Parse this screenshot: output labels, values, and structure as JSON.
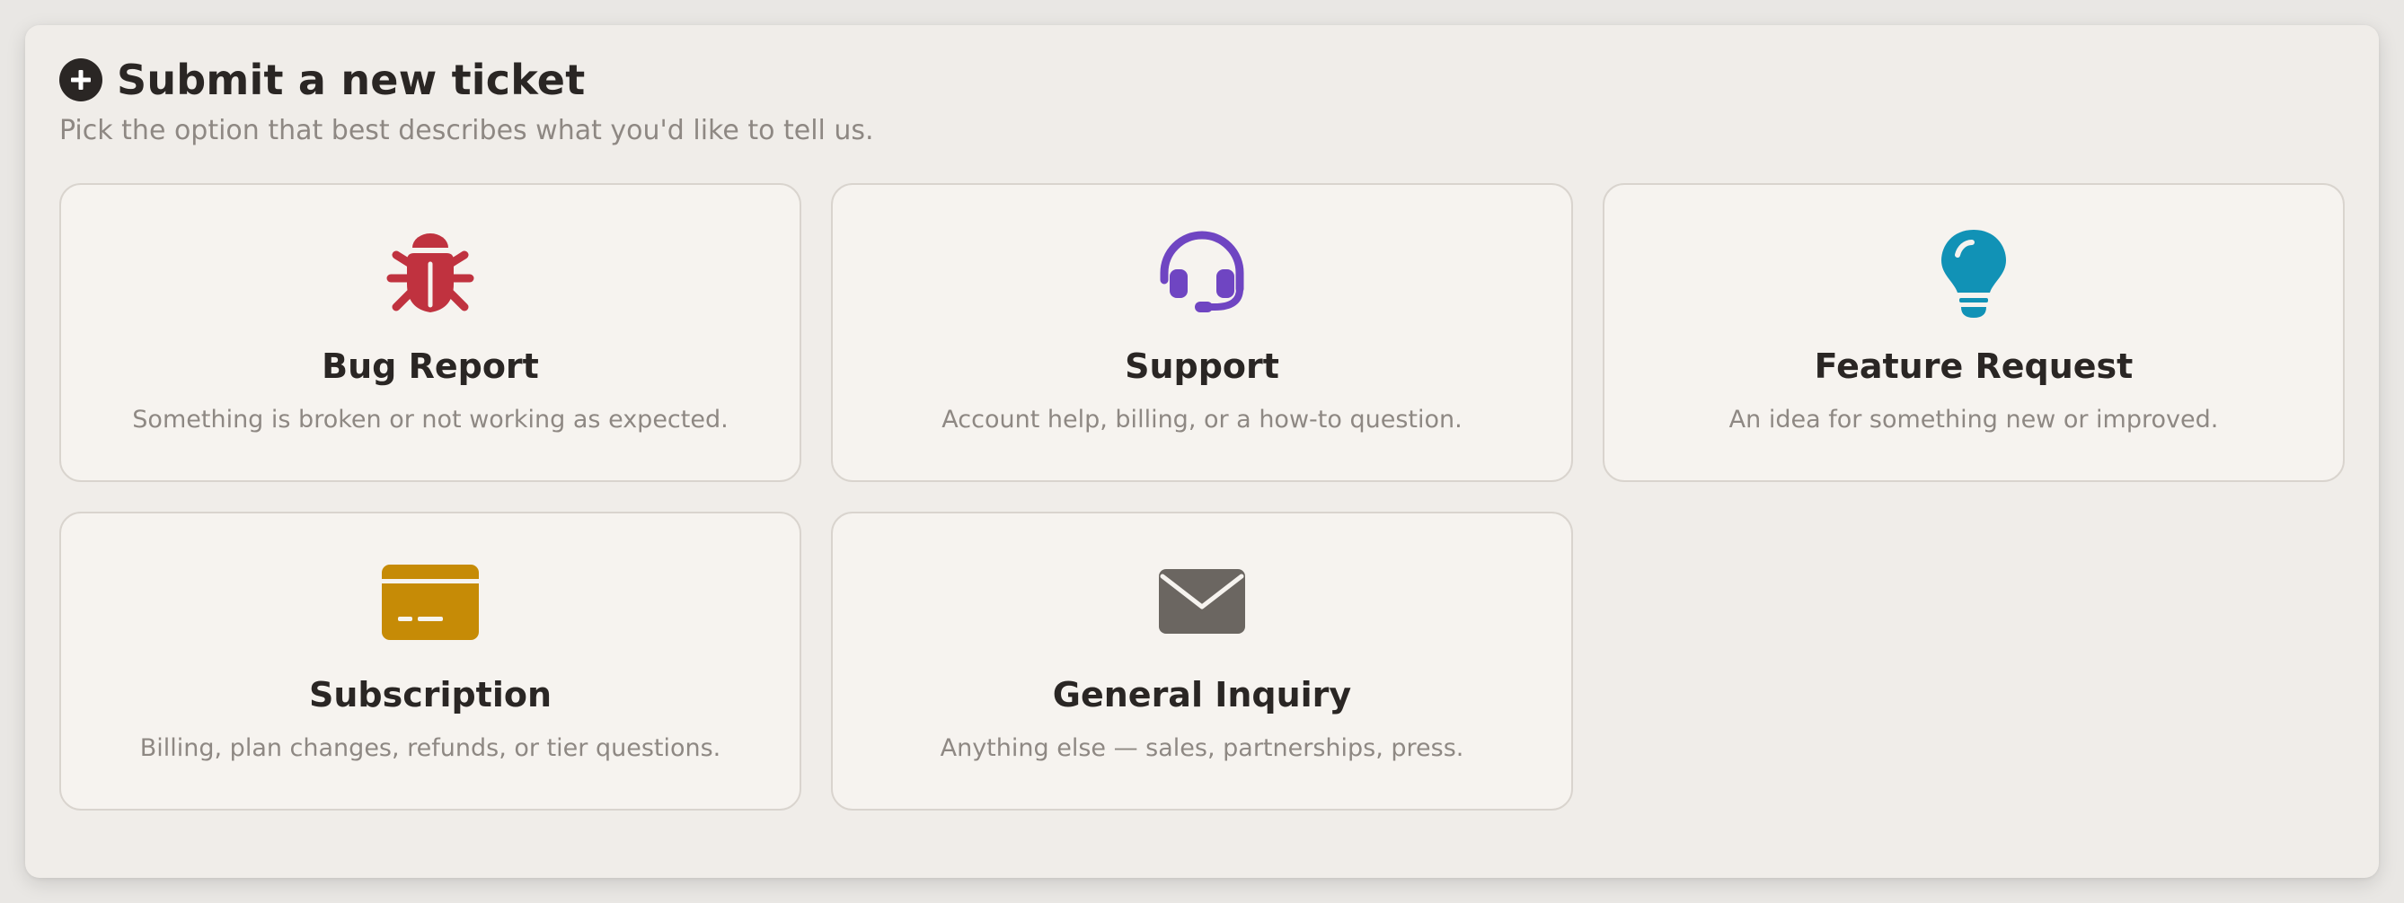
{
  "header": {
    "title": "Submit a new ticket",
    "subtitle": "Pick the option that best describes what you'd like to tell us."
  },
  "options": [
    {
      "title": "Bug Report",
      "description": "Something is broken or not working as expected.",
      "icon": "bug-icon",
      "color": "#c0323f"
    },
    {
      "title": "Support",
      "description": "Account help, billing, or a how-to question.",
      "icon": "headset-icon",
      "color": "#6f45c2"
    },
    {
      "title": "Feature Request",
      "description": "An idea for something new or improved.",
      "icon": "lightbulb-icon",
      "color": "#1192b6"
    },
    {
      "title": "Subscription",
      "description": "Billing, plan changes, refunds, or tier questions.",
      "icon": "credit-card-icon",
      "color": "#c68b06"
    },
    {
      "title": "General Inquiry",
      "description": "Anything else — sales, partnerships, press.",
      "icon": "envelope-icon",
      "color": "#6b6661"
    }
  ]
}
